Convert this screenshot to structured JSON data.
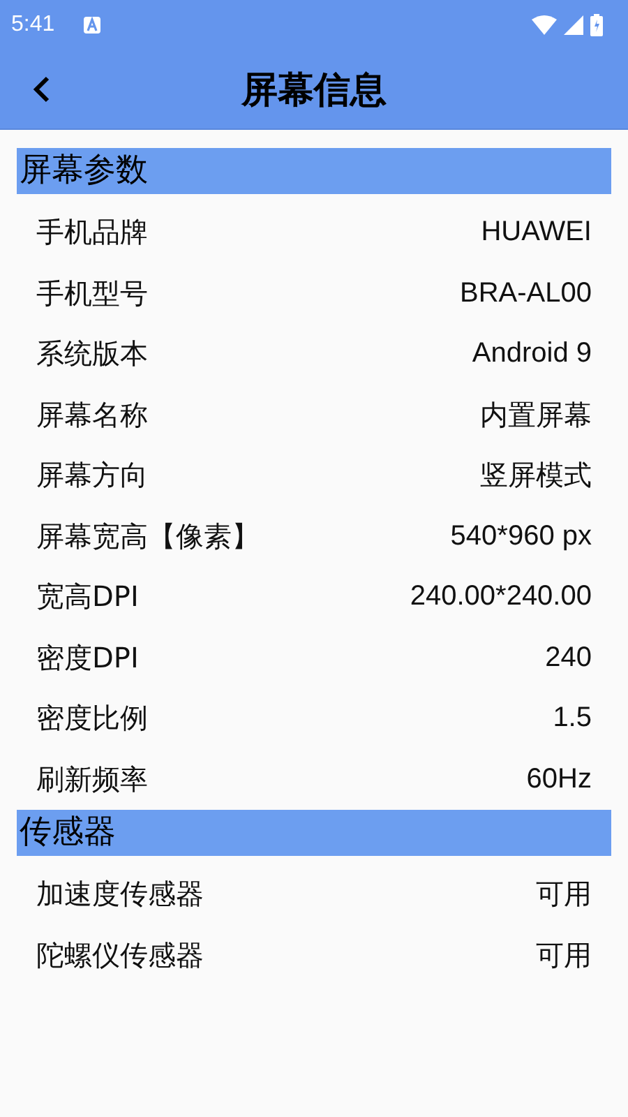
{
  "status_bar": {
    "time": "5:41"
  },
  "header": {
    "title": "屏幕信息"
  },
  "sections": [
    {
      "title": "屏幕参数",
      "rows": [
        {
          "label": "手机品牌",
          "value": "HUAWEI"
        },
        {
          "label": "手机型号",
          "value": "BRA-AL00"
        },
        {
          "label": "系统版本",
          "value": "Android 9"
        },
        {
          "label": "屏幕名称",
          "value": "内置屏幕"
        },
        {
          "label": "屏幕方向",
          "value": "竖屏模式"
        },
        {
          "label": "屏幕宽高【像素】",
          "value": "540*960 px"
        },
        {
          "label": "宽高DPI",
          "value": "240.00*240.00"
        },
        {
          "label": "密度DPI",
          "value": "240"
        },
        {
          "label": "密度比例",
          "value": "1.5"
        },
        {
          "label": "刷新频率",
          "value": "60Hz"
        }
      ]
    },
    {
      "title": "传感器",
      "rows": [
        {
          "label": "加速度传感器",
          "value": "可用"
        },
        {
          "label": "陀螺仪传感器",
          "value": "可用"
        }
      ]
    }
  ]
}
